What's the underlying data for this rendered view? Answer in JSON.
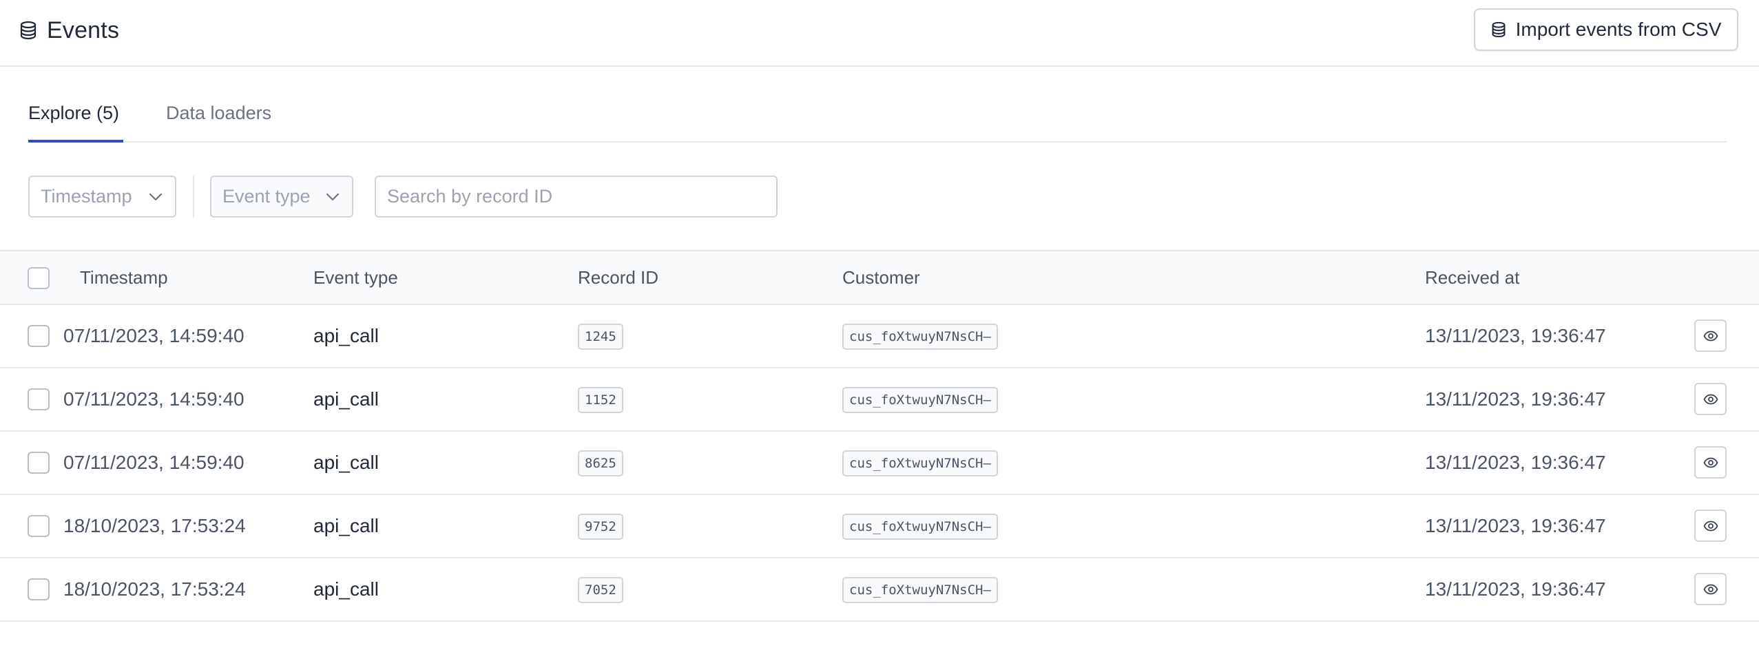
{
  "header": {
    "title": "Events",
    "title_icon": "database-icon",
    "import_button_label": "Import events from CSV",
    "import_button_icon": "database-icon"
  },
  "tabs": [
    {
      "label": "Explore (5)",
      "active": true
    },
    {
      "label": "Data loaders",
      "active": false
    }
  ],
  "filters": {
    "timestamp": {
      "placeholder": "Timestamp",
      "icon": "chevron-down-icon"
    },
    "event_type": {
      "placeholder": "Event type",
      "icon": "chevron-down-icon"
    },
    "search": {
      "placeholder": "Search by record ID",
      "value": ""
    }
  },
  "table": {
    "columns": {
      "timestamp": "Timestamp",
      "event_type": "Event type",
      "record_id": "Record ID",
      "customer": "Customer",
      "received_at": "Received at"
    },
    "rows": [
      {
        "timestamp": "07/11/2023, 14:59:40",
        "event_type": "api_call",
        "record_id": "1245",
        "customer": "cus_foXtwuyN7NsCH—",
        "received_at": "13/11/2023, 19:36:47"
      },
      {
        "timestamp": "07/11/2023, 14:59:40",
        "event_type": "api_call",
        "record_id": "1152",
        "customer": "cus_foXtwuyN7NsCH—",
        "received_at": "13/11/2023, 19:36:47"
      },
      {
        "timestamp": "07/11/2023, 14:59:40",
        "event_type": "api_call",
        "record_id": "8625",
        "customer": "cus_foXtwuyN7NsCH—",
        "received_at": "13/11/2023, 19:36:47"
      },
      {
        "timestamp": "18/10/2023, 17:53:24",
        "event_type": "api_call",
        "record_id": "9752",
        "customer": "cus_foXtwuyN7NsCH—",
        "received_at": "13/11/2023, 19:36:47"
      },
      {
        "timestamp": "18/10/2023, 17:53:24",
        "event_type": "api_call",
        "record_id": "7052",
        "customer": "cus_foXtwuyN7NsCH—",
        "received_at": "13/11/2023, 19:36:47"
      }
    ],
    "row_action_icon": "eye-icon"
  },
  "colors": {
    "accent": "#3048d6",
    "border": "#e5e7eb",
    "header_bg": "#f9fafb"
  }
}
